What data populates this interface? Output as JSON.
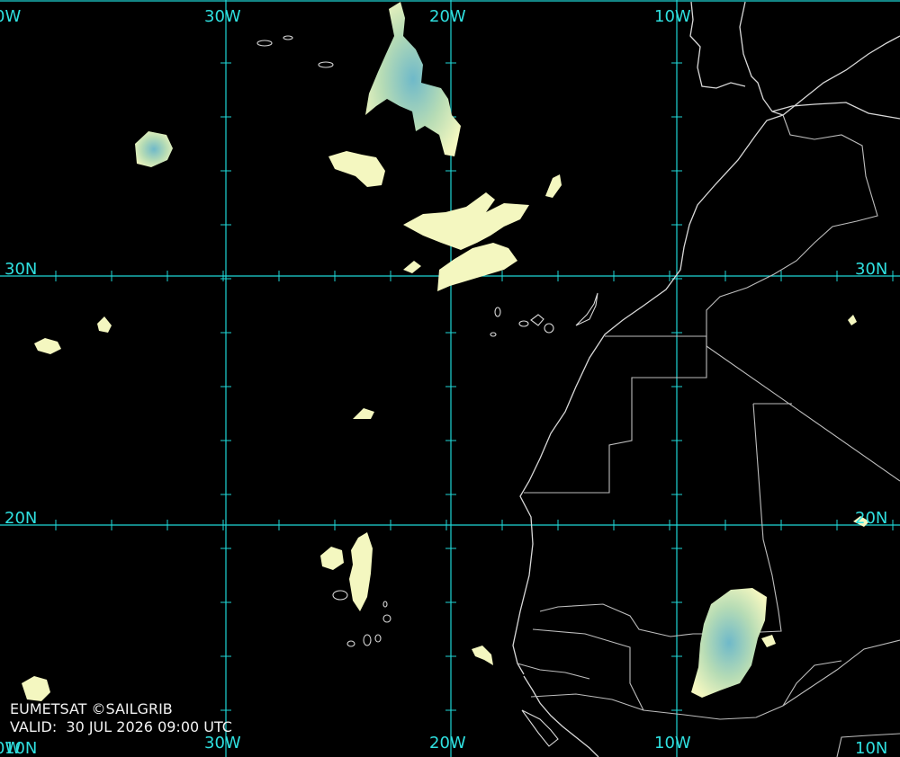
{
  "map": {
    "longitude_labels_top": [
      "0W",
      "30W",
      "20W",
      "10W"
    ],
    "longitude_labels_bottom": [
      "0W",
      "30W",
      "20W",
      "10W",
      "10N"
    ],
    "latitude_labels_left": [
      "30N",
      "20N",
      "10N"
    ],
    "latitude_labels_right": [
      "30N",
      "20N"
    ],
    "colors": {
      "background": "#000000",
      "graticule": "#1fd6d6",
      "coastline": "#d8d8d8",
      "cloud_light": "#f4f7c0",
      "cloud_dense": "#6fb9c9"
    }
  },
  "credit": {
    "source": "EUMETSAT ©SAILGRIB",
    "valid": "VALID:  30 JUL 2026 09:00 UTC"
  }
}
